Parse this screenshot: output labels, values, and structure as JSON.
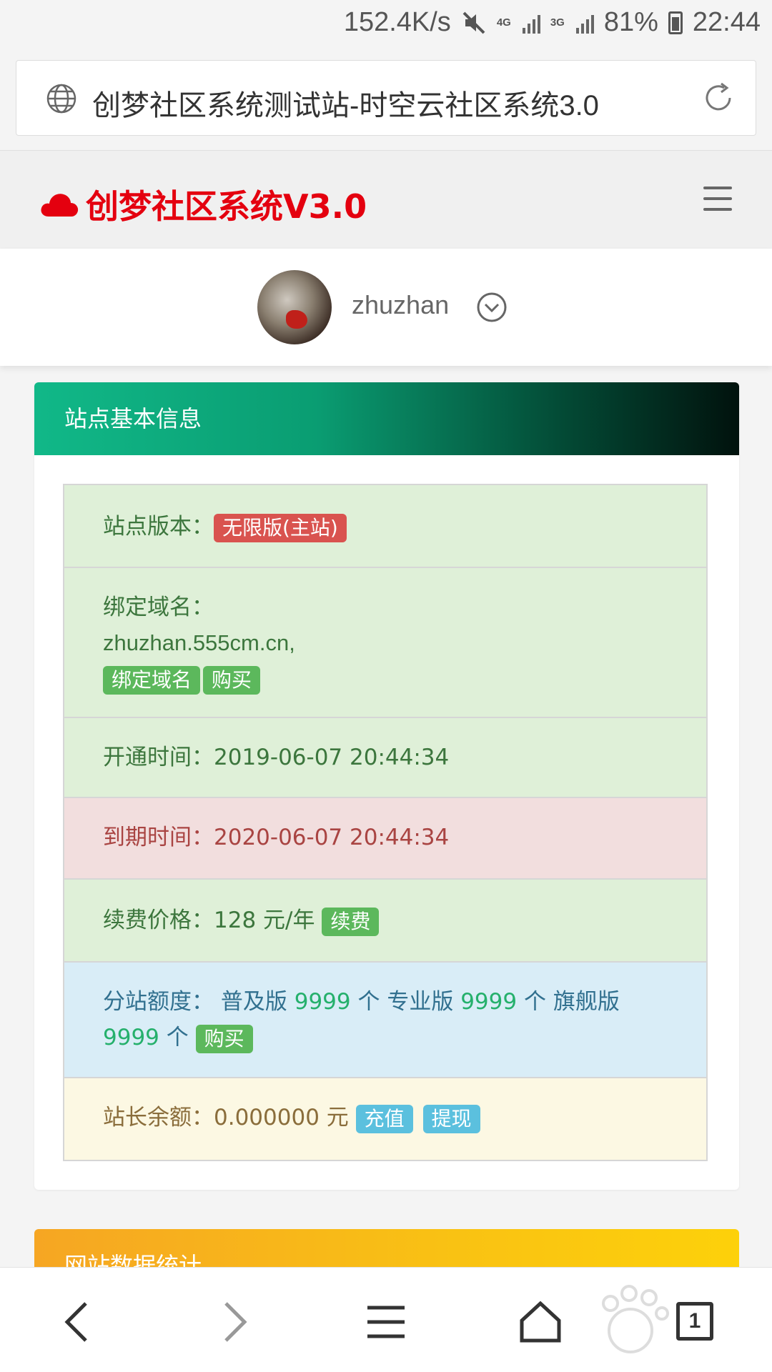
{
  "status_bar": {
    "speed": "152.4K/s",
    "net1": "4G",
    "net2": "3G",
    "battery": "81%",
    "time": "22:44"
  },
  "url_bar": {
    "title": "创梦社区系统测试站-时空云社区系统3.0"
  },
  "header": {
    "brand": "创梦社区系统V3.0",
    "brand_color": "#e4000f"
  },
  "user": {
    "name": "zhuzhan"
  },
  "panel": {
    "title": "站点基本信息",
    "version_label": "站点版本：",
    "version_badge": "无限版(主站)",
    "domain_label": "绑定域名：",
    "domain_value": "zhuzhan.555cm.cn,",
    "domain_bind_btn": "绑定域名",
    "domain_buy_btn": "购买",
    "open_time": "开通时间：2019-06-07 20:44:34",
    "expire_time": "到期时间：2020-06-07 20:44:34",
    "renew_label": "续费价格：128 元/年",
    "renew_btn": "续费",
    "quota_label": "分站额度：",
    "quota_basic": "普及版",
    "quota_basic_num": "9999",
    "quota_pro": "专业版",
    "quota_pro_num": "9999",
    "quota_flagship": "旗舰版",
    "quota_flagship_num": "9999",
    "quota_unit": "个",
    "quota_buy_btn": "购买",
    "balance_label": "站长余额：0.000000 元",
    "recharge_btn": "充值",
    "withdraw_btn": "提现"
  },
  "panel2": {
    "title": "网站数据统计"
  },
  "bottom_nav": {
    "tab_count": "1"
  }
}
